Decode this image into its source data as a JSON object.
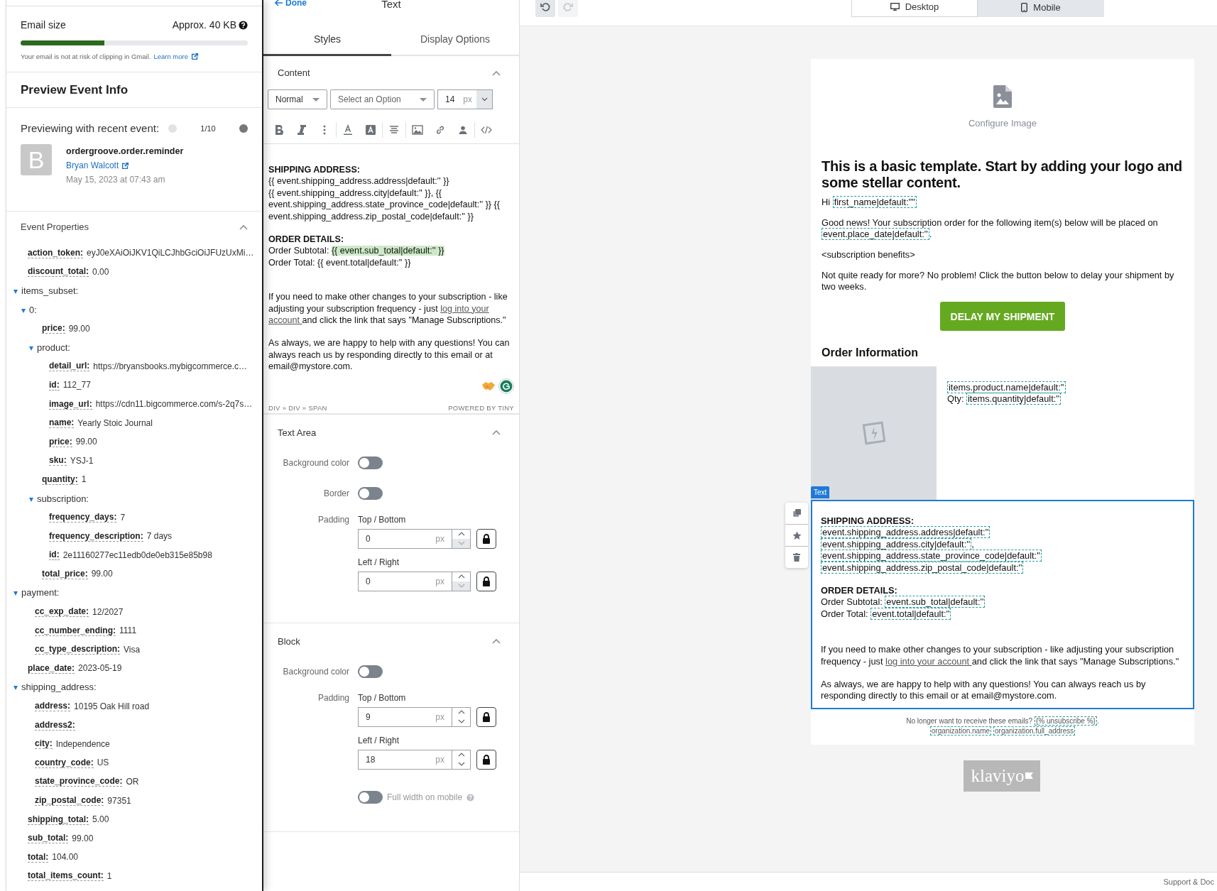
{
  "left_panel": {
    "email_size": {
      "label": "Email size",
      "value": "Approx. 40 KB",
      "level": 0.37,
      "note": "Your email is not at risk of clipping in Gmail.",
      "link": "Learn more"
    },
    "preview_title": "Preview Event Info",
    "preview": {
      "label": "Previewing with recent event:",
      "counter": "1/10",
      "prev_disabled": true,
      "next_disabled": false,
      "avatar": "B",
      "event_name": "ordergroove.order.reminder",
      "person": "Bryan Walcott",
      "date": "May 15, 2023 at 07:43 am"
    },
    "properties": {
      "title": "Event Properties",
      "expanded": true,
      "items": [
        {
          "key": "action_token:",
          "value": "eyJ0eXAiOiJKV1QiLCJhbGciOiJFUzUxMi…"
        },
        {
          "key": "discount_total:",
          "value": "0.00"
        },
        {
          "key": "items_subset:",
          "expanded": true,
          "children": [
            {
              "key": "0:",
              "expanded": true,
              "children": [
                {
                  "key": "price:",
                  "value": "99.00"
                },
                {
                  "key": "product:",
                  "expanded": true,
                  "children": [
                    {
                      "key": "detail_url:",
                      "value": "https://bryansbooks.mybigcommerce.c…"
                    },
                    {
                      "key": "id:",
                      "value": "112_77"
                    },
                    {
                      "key": "image_url:",
                      "value": "https://cdn11.bigcommerce.com/s-2q7s…"
                    },
                    {
                      "key": "name:",
                      "value": "Yearly Stoic Journal"
                    },
                    {
                      "key": "price:",
                      "value": "99.00"
                    },
                    {
                      "key": "sku:",
                      "value": "YSJ-1"
                    }
                  ]
                },
                {
                  "key": "quantity:",
                  "value": "1"
                },
                {
                  "key": "subscription:",
                  "expanded": true,
                  "children": [
                    {
                      "key": "frequency_days:",
                      "value": "7"
                    },
                    {
                      "key": "frequency_description:",
                      "value": "7 days"
                    },
                    {
                      "key": "id:",
                      "value": "2e11160277ec11edb0de0eb315e85b98"
                    }
                  ]
                },
                {
                  "key": "total_price:",
                  "value": "99.00"
                }
              ]
            }
          ]
        },
        {
          "key": "payment:",
          "expanded": true,
          "children": [
            {
              "key": "cc_exp_date:",
              "value": "12/2027"
            },
            {
              "key": "cc_number_ending:",
              "value": "1111"
            },
            {
              "key": "cc_type_description:",
              "value": "Visa"
            }
          ]
        },
        {
          "key": "place_date:",
          "value": "2023-05-19"
        },
        {
          "key": "shipping_address:",
          "expanded": true,
          "children": [
            {
              "key": "address:",
              "value": "10195 Oak Hill road"
            },
            {
              "key": "address2:"
            },
            {
              "key": "city:",
              "value": "Independence"
            },
            {
              "key": "country_code:",
              "value": "US"
            },
            {
              "key": "state_province_code:",
              "value": "OR"
            },
            {
              "key": "zip_postal_code:",
              "value": "97351"
            }
          ]
        },
        {
          "key": "shipping_total:",
          "value": "5.00"
        },
        {
          "key": "sub_total:",
          "value": "99.00"
        },
        {
          "key": "total:",
          "value": "104.00"
        },
        {
          "key": "total_items_count:",
          "value": "1"
        }
      ]
    }
  },
  "editor_panel": {
    "back": "Done",
    "title": "Text",
    "tabs": [
      {
        "label": "Styles",
        "selected": true
      },
      {
        "label": "Display Options",
        "selected": false
      }
    ],
    "content": {
      "title": "Content",
      "expanded": true,
      "block_format": "Normal",
      "font_family_placeholder": "Select an Option",
      "font_size": "14",
      "font_unit": "px",
      "document": [
        [
          [
            {
              "kind": "bold",
              "text": "SHIPPING ADDRESS:"
            }
          ],
          [
            {
              "kind": "text",
              "text": "{{ event.shipping_address.address|default:'' }}"
            }
          ],
          [
            {
              "kind": "text",
              "text": "{{ event.shipping_address.city|default:'' }}, {{"
            }
          ],
          [
            {
              "kind": "text",
              "text": "event.shipping_address.state_province_code|default:'' }} {{"
            }
          ],
          [
            {
              "kind": "text",
              "text": "event.shipping_address.zip_postal_code|default:'' }}"
            }
          ]
        ],
        [
          [
            {
              "kind": "bold",
              "text": "ORDER DETAILS:"
            }
          ],
          [
            {
              "kind": "text",
              "text": "Order Subtotal: "
            },
            {
              "kind": "highlight",
              "text": "{{ event.sub_total|default:'' }}"
            }
          ],
          [
            {
              "kind": "text",
              "text": "Order Total: {{ event.total|default:'' }}"
            }
          ]
        ],
        [
          [
            {
              "kind": "text",
              "text": "If you need to make other changes to your subscription - like"
            }
          ],
          [
            {
              "kind": "text",
              "text": "adjusting your subscription frequency - just "
            },
            {
              "kind": "link",
              "text": "log into your"
            }
          ],
          [
            {
              "kind": "link",
              "text": "account "
            },
            {
              "kind": "text",
              "text": "and click the link that says \"Manage Subscriptions.\""
            }
          ]
        ],
        [
          [
            {
              "kind": "text",
              "text": "As always, we are happy to help with any questions! You can"
            }
          ],
          [
            {
              "kind": "text",
              "text": "always reach us by responding directly to this email or at"
            }
          ],
          [
            {
              "kind": "text",
              "text": "email@mystore.com."
            }
          ]
        ]
      ],
      "path": "DIV » DIV » SPAN",
      "powered": "POWERED BY TINY"
    },
    "text_area": {
      "title": "Text Area",
      "expanded": true,
      "rows": [
        {
          "kind": "toggle",
          "label": "Background color",
          "on": false
        },
        {
          "kind": "toggle",
          "label": "Border",
          "on": false
        },
        {
          "kind": "padding",
          "label": "Padding",
          "fields": [
            {
              "label": "Top / Bottom",
              "value": "0",
              "unit": "px",
              "down_disabled": true
            },
            {
              "label": "Left / Right",
              "value": "0",
              "unit": "px",
              "down_disabled": true
            }
          ]
        }
      ]
    },
    "block": {
      "title": "Block",
      "expanded": true,
      "rows": [
        {
          "kind": "toggle",
          "label": "Background color",
          "on": false
        },
        {
          "kind": "padding",
          "label": "Padding",
          "fields": [
            {
              "label": "Top / Bottom",
              "value": "9",
              "unit": "px",
              "down_disabled": false
            },
            {
              "label": "Left / Right",
              "value": "18",
              "unit": "px",
              "down_disabled": false
            }
          ]
        },
        {
          "kind": "inline_toggle",
          "label": "Full width on mobile",
          "on": false
        }
      ]
    }
  },
  "canvas": {
    "undo_disabled": false,
    "redo_disabled": true,
    "views": [
      {
        "label": "Desktop",
        "selected": true
      },
      {
        "label": "Mobile",
        "selected": false
      }
    ],
    "email": {
      "image_label": "Configure Image",
      "heading": "This is a basic template. Start by adding your logo and some stellar content.",
      "paragraphs": [
        [
          {
            "kind": "text",
            "text": "Hi "
          },
          {
            "kind": "tag",
            "text": "first_name|default:\"\""
          }
        ],
        [
          {
            "kind": "text",
            "text": "Good news! Your subscription order for the following item(s) below will be placed on "
          },
          {
            "kind": "tag",
            "text": "event.place_date|default:''"
          },
          {
            "kind": "text",
            "text": "."
          }
        ],
        [
          {
            "kind": "text",
            "text": "<subscription benefits>"
          }
        ],
        [
          {
            "kind": "text",
            "text": "Not quite ready for more? No problem! Click the button below to delay your shipment by two weeks."
          }
        ]
      ],
      "button": "DELAY MY SHIPMENT",
      "section_title": "Order Information",
      "product_lines": [
        [
          {
            "kind": "tag",
            "text": "items.product.name|default:''"
          }
        ],
        [
          {
            "kind": "text",
            "text": "Qty: "
          },
          {
            "kind": "tag",
            "text": "items.quantity|default:''"
          }
        ]
      ],
      "selected_block": {
        "label": "Text",
        "paragraphs": [
          [
            [
              {
                "kind": "bold",
                "text": "SHIPPING ADDRESS:"
              }
            ],
            [
              {
                "kind": "tag",
                "text": "event.shipping_address.address|default:''"
              }
            ],
            [
              {
                "kind": "tag",
                "text": "event.shipping_address.city|default:''"
              },
              {
                "kind": "text",
                "text": ","
              }
            ],
            [
              {
                "kind": "tag",
                "text": "event.shipping_address.state_province_code|default:''"
              }
            ],
            [
              {
                "kind": "tag",
                "text": "event.shipping_address.zip_postal_code|default:''"
              }
            ]
          ],
          [
            [
              {
                "kind": "bold",
                "text": "ORDER DETAILS:"
              }
            ],
            [
              {
                "kind": "text",
                "text": "Order Subtotal: "
              },
              {
                "kind": "tag",
                "text": "event.sub_total|default:''"
              }
            ],
            [
              {
                "kind": "text",
                "text": "Order Total: "
              },
              {
                "kind": "tag",
                "text": "event.total|default:''"
              }
            ]
          ],
          [
            [
              {
                "kind": "text",
                "text": "If you need to make other changes to your subscription - like adjusting your subscription frequency - just "
              },
              {
                "kind": "link",
                "text": "log into your account "
              },
              {
                "kind": "text",
                "text": "and click the link that says \"Manage Subscriptions.\""
              }
            ]
          ],
          [
            [
              {
                "kind": "text",
                "text": "As always, we are happy to help with any questions! You can always reach us by responding directly to this email or at email@mystore.com."
              }
            ]
          ]
        ]
      },
      "footer_lines": [
        [
          {
            "kind": "text",
            "text": "No longer want to receive these emails? "
          },
          {
            "kind": "tag",
            "text": "{% unsubscribe %}"
          },
          {
            "kind": "text",
            "text": "."
          }
        ],
        [
          {
            "kind": "tag",
            "text": "organization.name"
          },
          {
            "kind": "tag",
            "text": "organization.full_address"
          }
        ]
      ]
    },
    "brand": "klaviyo",
    "support": "Support & Doc"
  }
}
